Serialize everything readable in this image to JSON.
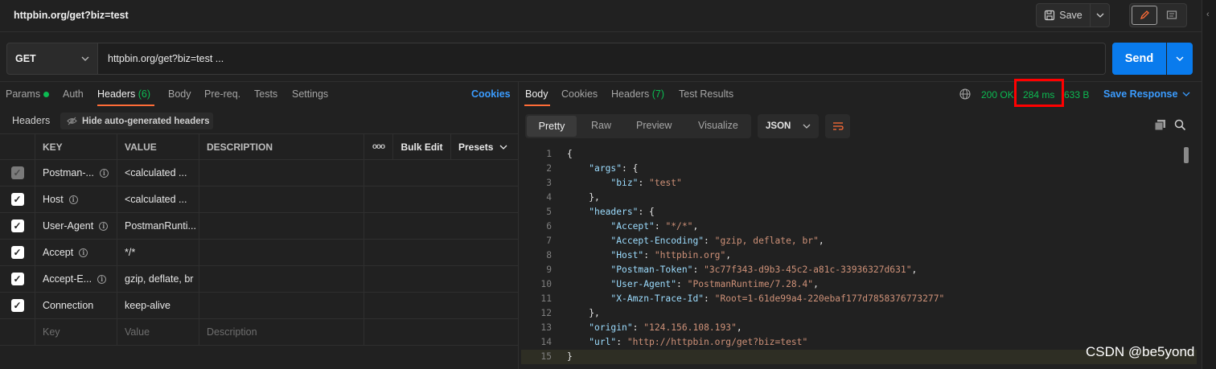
{
  "tab": {
    "title": "httpbin.org/get?biz=test"
  },
  "toolbar": {
    "save_label": "Save"
  },
  "request": {
    "method": "GET",
    "url": "httpbin.org/get?biz=test ..."
  },
  "send": {
    "label": "Send"
  },
  "request_tabs": {
    "params": "Params",
    "auth": "Auth",
    "headers": "Headers",
    "headers_count": "(6)",
    "body": "Body",
    "prereq": "Pre-req.",
    "tests": "Tests",
    "settings": "Settings",
    "cookies": "Cookies"
  },
  "headers_section": {
    "title": "Headers",
    "hide_auto": "Hide auto-generated headers"
  },
  "table": {
    "columns": {
      "key": "KEY",
      "value": "VALUE",
      "description": "DESCRIPTION",
      "more": "ooo",
      "bulk_edit": "Bulk Edit",
      "presets": "Presets"
    },
    "rows": [
      {
        "key": "Postman-...",
        "value": "<calculated ...",
        "checked": "disabled"
      },
      {
        "key": "Host",
        "value": "<calculated ...",
        "checked": "true"
      },
      {
        "key": "User-Agent",
        "value": "PostmanRunti...",
        "checked": "true"
      },
      {
        "key": "Accept",
        "value": "*/*",
        "checked": "true"
      },
      {
        "key": "Accept-E...",
        "value": "gzip, deflate, br",
        "checked": "true"
      },
      {
        "key": "Connection",
        "value": "keep-alive",
        "checked": "true"
      }
    ],
    "placeholder": {
      "key": "Key",
      "value": "Value",
      "description": "Description"
    }
  },
  "response_tabs": {
    "body": "Body",
    "cookies": "Cookies",
    "headers": "Headers",
    "headers_count": "(7)",
    "test_results": "Test Results"
  },
  "response_meta": {
    "status": "200 OK",
    "time": "284 ms",
    "size": "633 B",
    "save_response": "Save Response"
  },
  "view_tabs": {
    "pretty": "Pretty",
    "raw": "Raw",
    "preview": "Preview",
    "visualize": "Visualize",
    "format": "JSON"
  },
  "code_lines": [
    "{",
    "    \"args\": {",
    "        \"biz\": \"test\"",
    "    },",
    "    \"headers\": {",
    "        \"Accept\": \"*/*\",",
    "        \"Accept-Encoding\": \"gzip, deflate, br\",",
    "        \"Host\": \"httpbin.org\",",
    "        \"Postman-Token\": \"3c77f343-d9b3-45c2-a81c-33936327d631\",",
    "        \"User-Agent\": \"PostmanRuntime/7.28.4\",",
    "        \"X-Amzn-Trace-Id\": \"Root=1-61de99a4-220ebaf177d7858376773277\"",
    "    },",
    "    \"origin\": \"124.156.108.193\",",
    "    \"url\": \"http://httpbin.org/get?biz=test\"",
    "}"
  ],
  "watermark": "CSDN @be5yond",
  "colors": {
    "accent": "#ff6c37",
    "send": "#097bed",
    "success": "#0cbb52",
    "link": "#3b9cff",
    "highlight": "#ff0000"
  }
}
